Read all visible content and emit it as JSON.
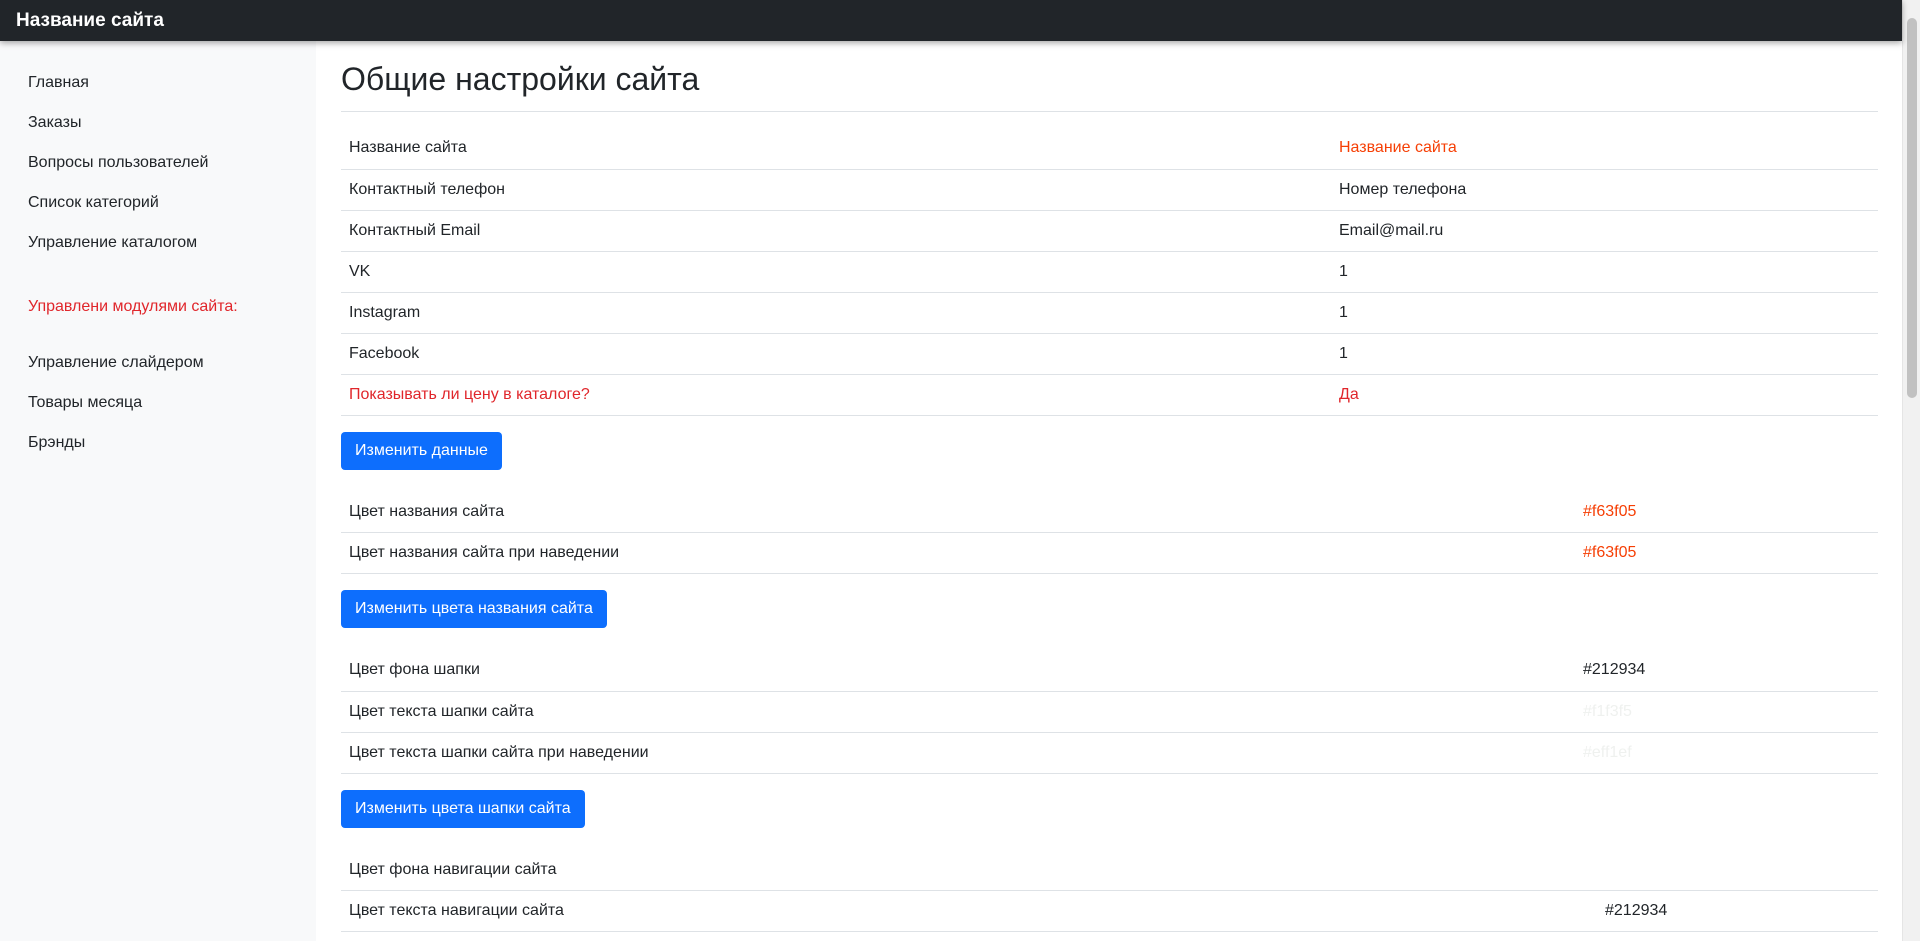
{
  "header": {
    "brand": "Название сайта"
  },
  "sidebar": {
    "items": [
      {
        "label": "Главная",
        "name": "sidebar-item-home"
      },
      {
        "label": "Заказы",
        "name": "sidebar-item-orders"
      },
      {
        "label": "Вопросы пользователей",
        "name": "sidebar-item-user-questions"
      },
      {
        "label": "Список категорий",
        "name": "sidebar-item-categories"
      },
      {
        "label": "Управление каталогом",
        "name": "sidebar-item-catalog"
      }
    ],
    "modules_heading": "Управлени модулями сайта:",
    "module_items": [
      {
        "label": "Управление слайдером",
        "name": "sidebar-item-slider"
      },
      {
        "label": "Товары месяца",
        "name": "sidebar-item-products-of-month"
      },
      {
        "label": "Брэнды",
        "name": "sidebar-item-brands"
      }
    ]
  },
  "main": {
    "title": "Общие настройки сайта",
    "general": {
      "rows": [
        {
          "label": "Название сайта",
          "value": "Название сайта"
        },
        {
          "label": "Контактный телефон",
          "value": "Номер телефона"
        },
        {
          "label": "Контактный Email",
          "value": "Email@mail.ru"
        },
        {
          "label": "VK",
          "value": "1"
        },
        {
          "label": "Instagram",
          "value": "1"
        },
        {
          "label": "Facebook",
          "value": "1"
        },
        {
          "label": "Показывать ли цену в каталоге?",
          "value": "Да"
        }
      ],
      "button": "Изменить данные"
    },
    "title_colors": {
      "rows": [
        {
          "label": "Цвет названия сайта",
          "value": "#f63f05"
        },
        {
          "label": "Цвет названия сайта при наведении",
          "value": "#f63f05"
        }
      ],
      "button": "Изменить цвета названия сайта"
    },
    "header_colors": {
      "rows": [
        {
          "label": "Цвет фона шапки",
          "value": "#212934"
        },
        {
          "label": "Цвет текста шапки сайта",
          "value": "#f1f3f5"
        },
        {
          "label": "Цвет текста шапки сайта при наведении",
          "value": "#eff1ef"
        }
      ],
      "button": "Изменить цвета шапки сайта"
    },
    "nav_colors": {
      "rows": [
        {
          "label": "Цвет фона навигации сайта",
          "value": ""
        },
        {
          "label": "Цвет текста навигации сайта",
          "value": "#212934"
        }
      ]
    }
  },
  "colors": {
    "header_bg": "#212529",
    "sidebar_bg": "#f8f9fa",
    "accent_red": "#e0262b",
    "accent_orange": "#f63f05",
    "button_blue": "#0d6efd"
  }
}
